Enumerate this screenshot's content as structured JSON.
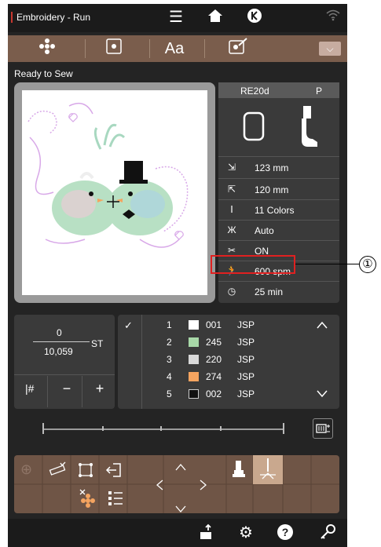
{
  "statusbar": {
    "title": "Embroidery - Run"
  },
  "tabs": {
    "font_label": "Aa"
  },
  "status_text": "Ready to Sew",
  "info": {
    "head_left": "RE20d",
    "head_right": "P",
    "width": "123 mm",
    "height": "120 mm",
    "colors": "11 Colors",
    "jump_trim": "Auto",
    "thread_cut": "ON",
    "speed": "600 spm",
    "time": "25 min"
  },
  "callout": "①",
  "stitch": {
    "current": "0",
    "total": "10,059",
    "unit": "ST",
    "minus": "−",
    "plus": "+"
  },
  "color_list": [
    {
      "num": "1",
      "color": "#ffffff",
      "code": "001",
      "brand": "JSP"
    },
    {
      "num": "2",
      "color": "#a8d8a8",
      "code": "245",
      "brand": "JSP"
    },
    {
      "num": "3",
      "color": "#d8d8d8",
      "code": "220",
      "brand": "JSP"
    },
    {
      "num": "4",
      "color": "#f4a460",
      "code": "274",
      "brand": "JSP"
    },
    {
      "num": "5",
      "color": "#111111",
      "code": "002",
      "brand": "JSP"
    }
  ],
  "accent_color": "#e02020",
  "toolbar_color": "#7a5d4c"
}
